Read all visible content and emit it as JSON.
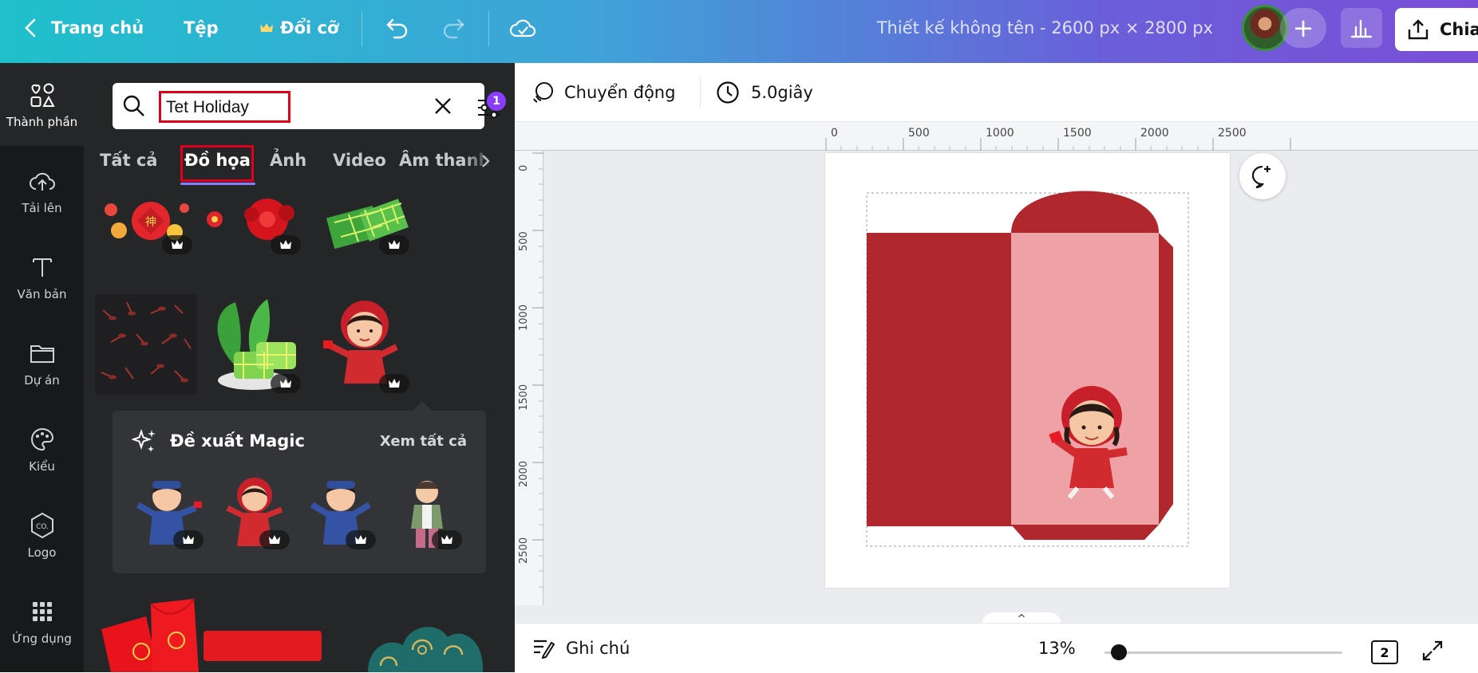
{
  "topbar": {
    "back_icon": "chevron-left-icon",
    "home_label": "Trang chủ",
    "file_label": "Tệp",
    "resize_label": "Đổi cỡ",
    "undo_icon": "undo-icon",
    "redo_icon": "redo-icon",
    "save_status_icon": "cloud-check-icon",
    "document_title": "Thiết kế không tên - 2600 px × 2800 px",
    "add_icon": "plus-icon",
    "insights_icon": "bar-chart-icon",
    "share_label": "Chia"
  },
  "rail": {
    "items": [
      {
        "label": "Thành phần",
        "icon": "elements-icon"
      },
      {
        "label": "Tải lên",
        "icon": "upload-cloud-icon"
      },
      {
        "label": "Văn bản",
        "icon": "text-icon"
      },
      {
        "label": "Dự án",
        "icon": "folder-icon"
      },
      {
        "label": "Kiểu",
        "icon": "palette-icon"
      },
      {
        "label": "Logo",
        "icon": "logo-icon"
      },
      {
        "label": "Ứng dụng",
        "icon": "apps-grid-icon"
      }
    ]
  },
  "panel": {
    "search": {
      "value": "Tet Holiday",
      "filter_count": "1"
    },
    "tabs": [
      {
        "label": "Tất cả"
      },
      {
        "label": "Đồ họa"
      },
      {
        "label": "Ảnh"
      },
      {
        "label": "Video"
      },
      {
        "label": "Âm thanh"
      }
    ],
    "magic": {
      "title": "Đề xuất Magic",
      "see_all": "Xem tất cả"
    }
  },
  "canvas_toolbar": {
    "animation_label": "Chuyển động",
    "duration_label": "5.0giây"
  },
  "ruler": {
    "h_labels": [
      "0",
      "500",
      "1000",
      "1500",
      "2000",
      "2500"
    ],
    "v_labels": [
      "0",
      "500",
      "1000",
      "1500",
      "2000",
      "2500"
    ]
  },
  "bottombar": {
    "notes_label": "Ghi chú",
    "zoom": "13%",
    "page_count": "2"
  },
  "colors": {
    "brand_gradient_start": "#1fc0cc",
    "brand_gradient_end": "#7a4ed8",
    "envelope_dark": "#b0282d",
    "envelope_light": "#eea2a6",
    "highlight": "#e0001b",
    "accent": "#8b3dff"
  }
}
